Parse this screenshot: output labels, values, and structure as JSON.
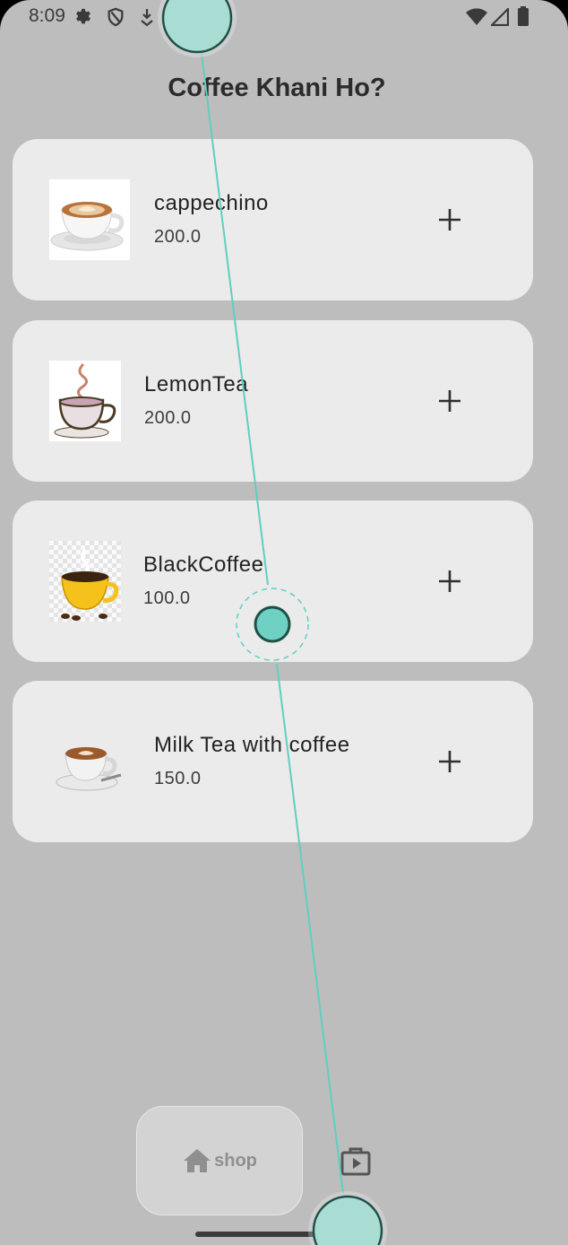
{
  "status_bar": {
    "time": "8:09",
    "left_icons": [
      "gear-icon",
      "shield-icon",
      "download-icon",
      "app-notification-icon"
    ],
    "right_icons": [
      "wifi-icon",
      "signal-icon",
      "battery-icon"
    ]
  },
  "page": {
    "title": "Coffee Khani Ho?"
  },
  "items": [
    {
      "name": "cappechino",
      "price": "200.0",
      "image": "latte-art-cup-image"
    },
    {
      "name": "LemonTea",
      "price": "200.0",
      "image": "tea-cup-steam-image"
    },
    {
      "name": "BlackCoffee",
      "price": "100.0",
      "image": "yellow-coffee-cup-image"
    },
    {
      "name": "Milk Tea with coffee",
      "price": "150.0",
      "image": "latte-cup-saucer-image"
    }
  ],
  "add_icon": "plus-icon",
  "bottom_nav": {
    "shop_label": "shop",
    "shop_icon": "home-icon",
    "second_icon": "shopping-bag-icon"
  },
  "colors": {
    "screen_bg": "#bdbdbd",
    "card_bg": "#ebebeb",
    "touch_overlay": "#6fd1c4"
  }
}
